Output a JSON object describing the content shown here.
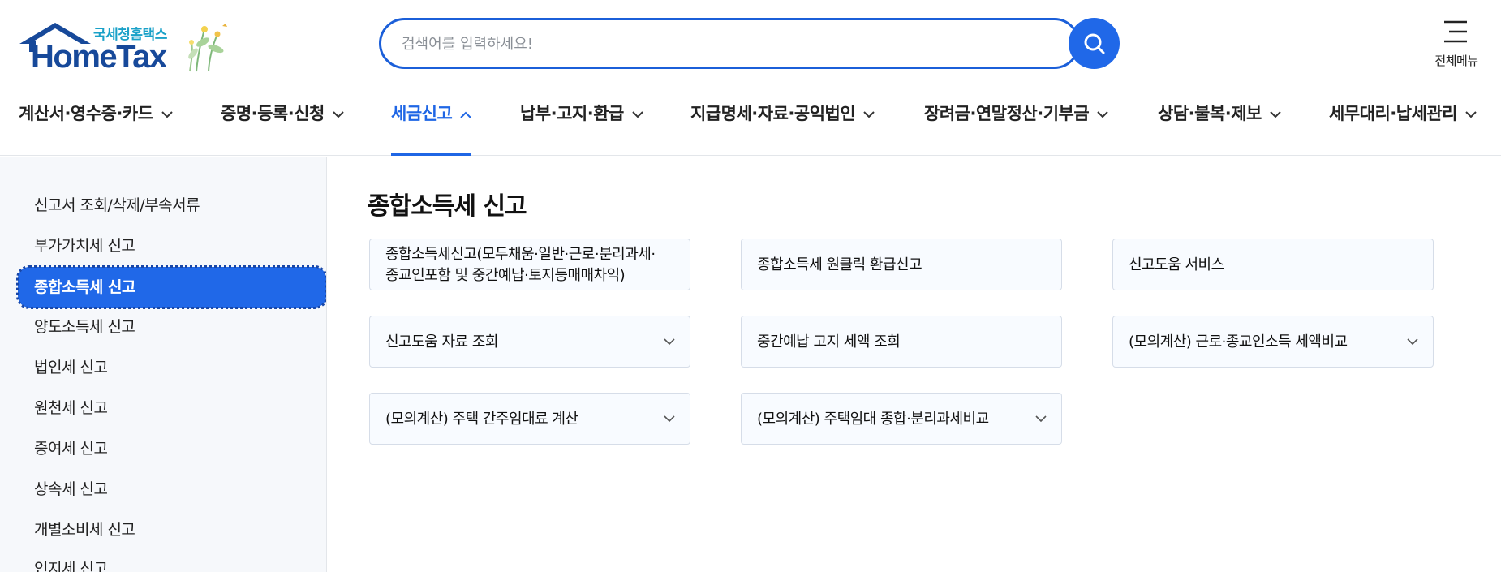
{
  "logo": {
    "korean": "국세청홈택스",
    "english": "HomeTax"
  },
  "search": {
    "placeholder": "검색어를 입력하세요!",
    "value": ""
  },
  "all_menu": {
    "label": "전체메뉴"
  },
  "nav": [
    {
      "label": "계산서·영수증·카드",
      "active": false
    },
    {
      "label": "증명·등록·신청",
      "active": false
    },
    {
      "label": "세금신고",
      "active": true
    },
    {
      "label": "납부·고지·환급",
      "active": false
    },
    {
      "label": "지급명세·자료·공익법인",
      "active": false
    },
    {
      "label": "장려금·연말정산·기부금",
      "active": false
    },
    {
      "label": "상담·불복·제보",
      "active": false
    },
    {
      "label": "세무대리·납세관리",
      "active": false
    }
  ],
  "sidebar": {
    "items": [
      {
        "label": "신고서 조회/삭제/부속서류",
        "active": false
      },
      {
        "label": "부가가치세 신고",
        "active": false
      },
      {
        "label": "종합소득세 신고",
        "active": true
      },
      {
        "label": "양도소득세 신고",
        "active": false
      },
      {
        "label": "법인세 신고",
        "active": false
      },
      {
        "label": "원천세 신고",
        "active": false
      },
      {
        "label": "증여세 신고",
        "active": false
      },
      {
        "label": "상속세 신고",
        "active": false
      },
      {
        "label": "개별소비세 신고",
        "active": false
      },
      {
        "label": "인지세 신고",
        "active": false
      }
    ]
  },
  "main": {
    "title": "종합소득세 신고",
    "cards": [
      {
        "label": "종합소득세신고(모두채움·일반·근로·분리과세·종교인포함 및 중간예납·토지등매매차익)",
        "has_dropdown": false
      },
      {
        "label": "종합소득세 원클릭 환급신고",
        "has_dropdown": false
      },
      {
        "label": "신고도움 서비스",
        "has_dropdown": false
      },
      {
        "label": "신고도움 자료 조회",
        "has_dropdown": true
      },
      {
        "label": "중간예납 고지 세액 조회",
        "has_dropdown": false
      },
      {
        "label": "(모의계산) 근로·종교인소득 세액비교",
        "has_dropdown": true
      },
      {
        "label": "(모의계산) 주택 간주임대료 계산",
        "has_dropdown": true
      },
      {
        "label": "(모의계산) 주택임대 종합·분리과세비교",
        "has_dropdown": true
      }
    ]
  },
  "colors": {
    "primary": "#2068e8",
    "brand_navy": "#17499a",
    "brand_teal": "#1aa1c8",
    "sidebar_bg": "#f6f8fb"
  }
}
